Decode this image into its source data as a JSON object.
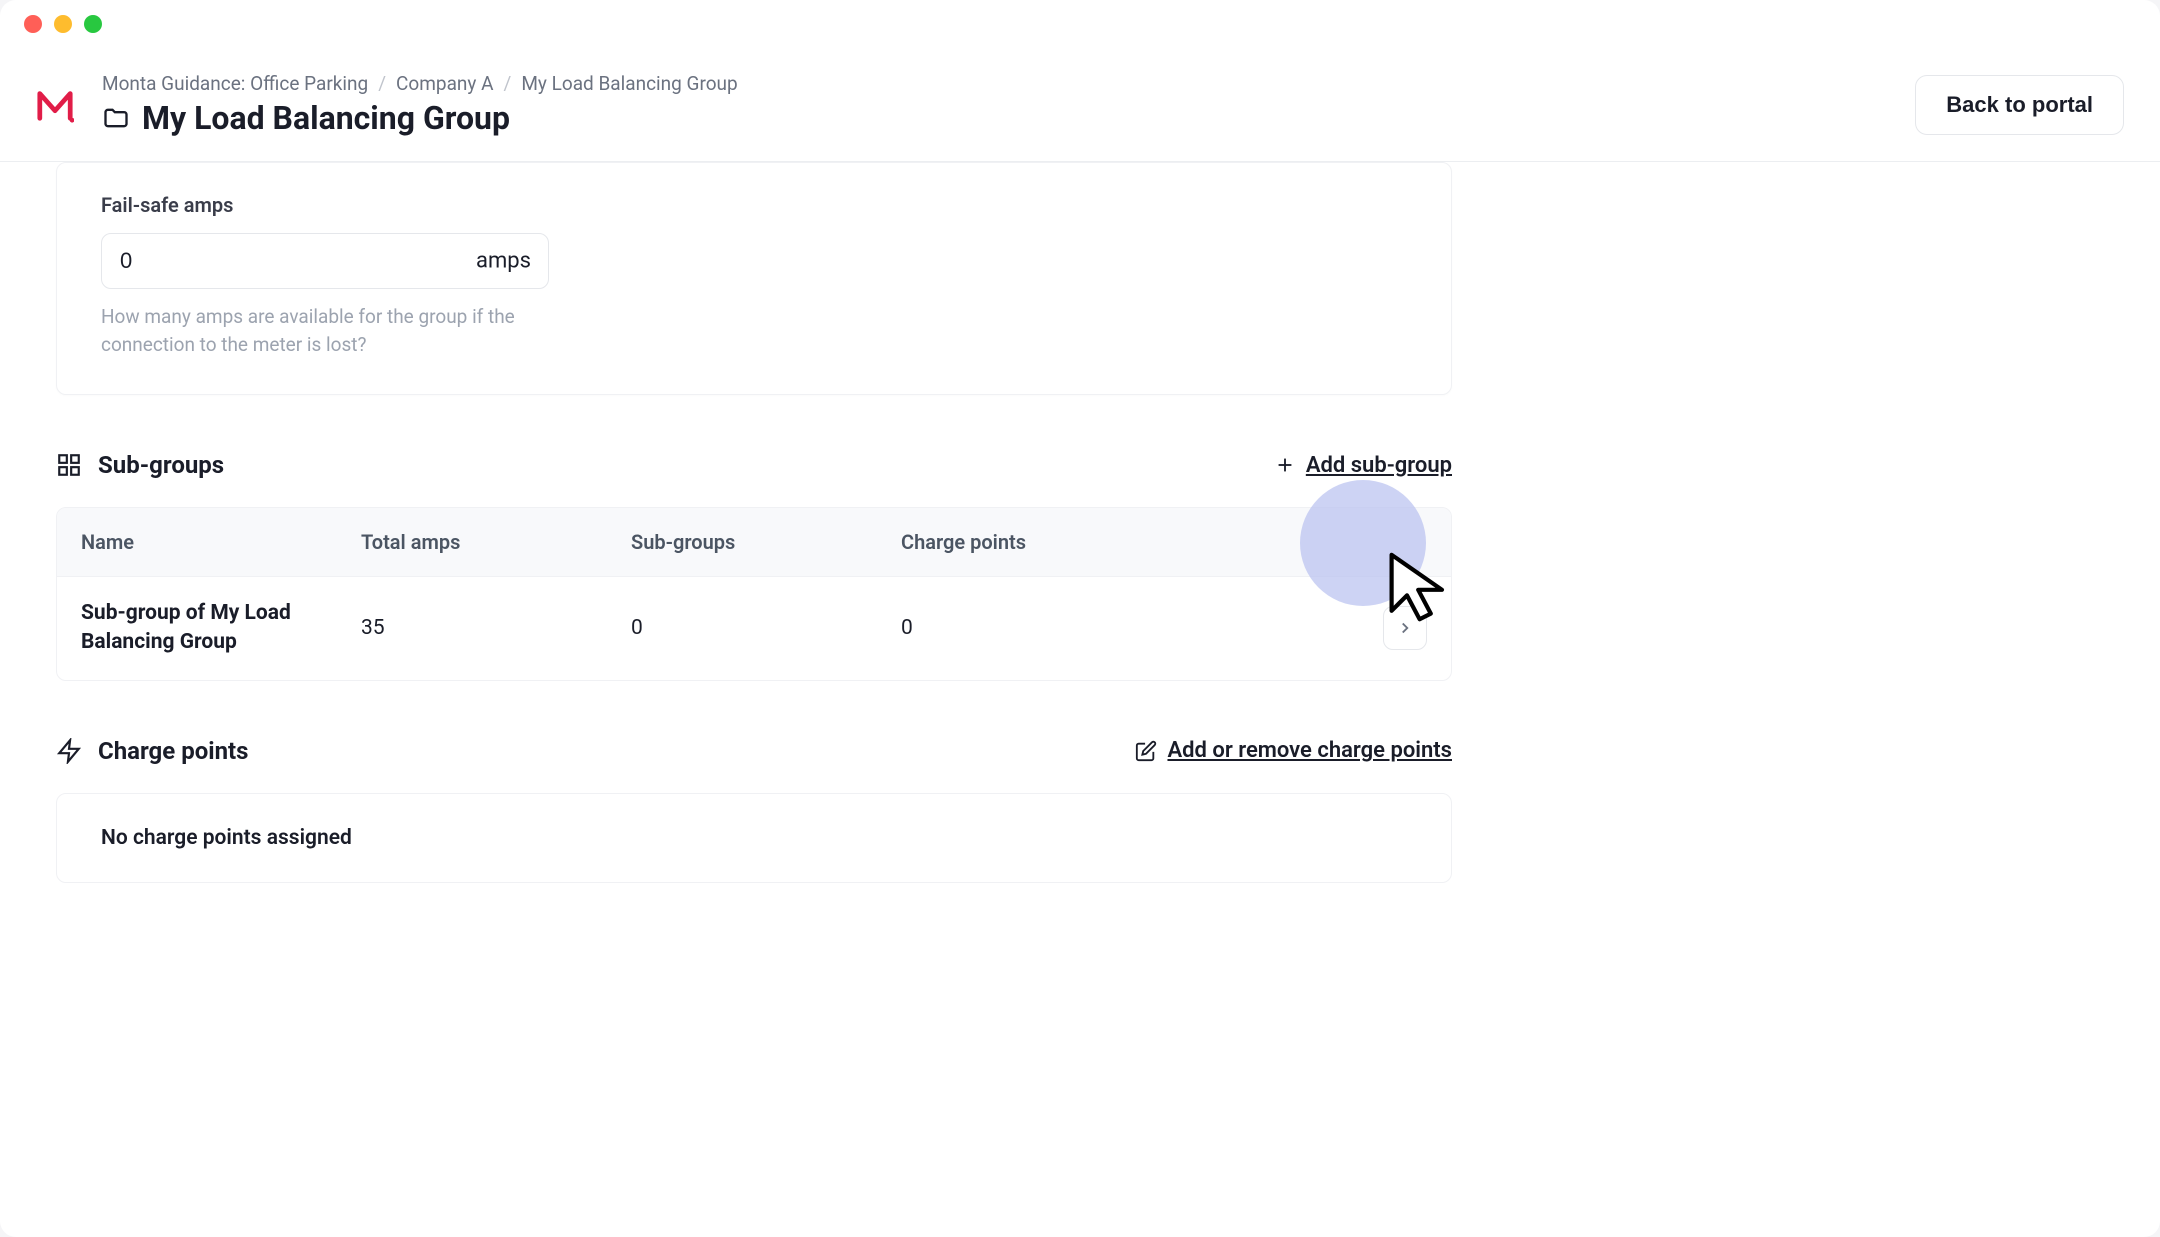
{
  "breadcrumb": {
    "items": [
      "Monta Guidance: Office Parking",
      "Company A",
      "My Load Balancing Group"
    ]
  },
  "page": {
    "title": "My Load Balancing Group"
  },
  "header": {
    "back_button": "Back to portal"
  },
  "failsafe": {
    "label": "Fail-safe amps",
    "value": "0",
    "unit": "amps",
    "help": "How many amps are available for the group if the connection to the meter is lost?"
  },
  "subgroups": {
    "title": "Sub-groups",
    "add_label": "Add sub-group",
    "columns": {
      "name": "Name",
      "total_amps": "Total amps",
      "sub_groups": "Sub-groups",
      "charge_points": "Charge points"
    },
    "rows": [
      {
        "name": "Sub-group of My Load Balancing Group",
        "total_amps": "35",
        "sub_groups": "0",
        "charge_points": "0"
      }
    ]
  },
  "chargepoints": {
    "title": "Charge points",
    "action_label": "Add or remove charge points",
    "empty": "No charge points assigned"
  }
}
